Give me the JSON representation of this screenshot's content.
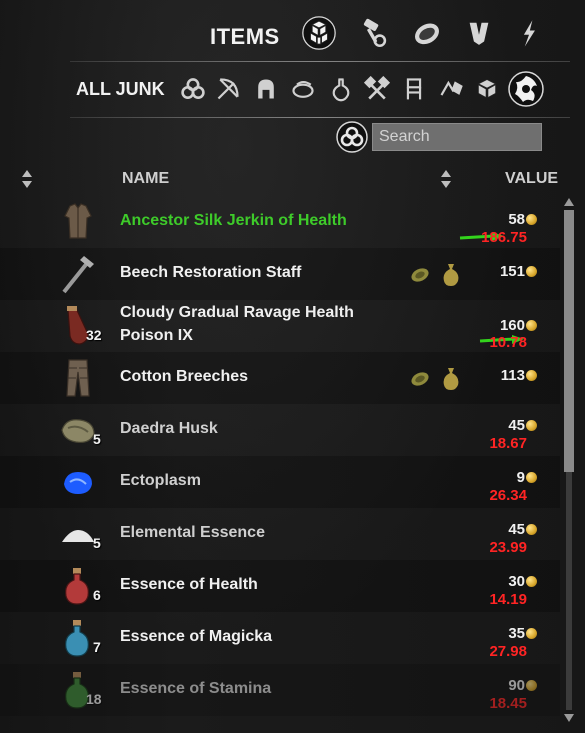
{
  "header": {
    "title": "ITEMS",
    "tabs": [
      {
        "icon": "all-items-cube-icon",
        "selected": true
      },
      {
        "icon": "materials-hammer-icon",
        "selected": false
      },
      {
        "icon": "consumables-food-icon",
        "selected": false
      },
      {
        "icon": "armor-icon",
        "selected": false
      },
      {
        "icon": "weapons-lightning-icon",
        "selected": false
      }
    ]
  },
  "subheader": {
    "title": "ALL JUNK",
    "filters": [
      "all-triquetra-icon",
      "bow-icon",
      "helmet-icon",
      "food-icon",
      "potion-icon",
      "crafting-tools-icon",
      "furnishing-icon",
      "runes-icon",
      "blocks-icon",
      "junk-selected-icon"
    ]
  },
  "search": {
    "placeholder": "Search",
    "value": ""
  },
  "columns": {
    "name": "NAME",
    "value": "VALUE"
  },
  "items": [
    {
      "name": "Ancestor Silk Jerkin of Health",
      "quality_color": "#3ecb2a",
      "value": "58",
      "sell": "186.75",
      "qty": "",
      "icon": "jerkin-icon",
      "traits": false,
      "arrow": true
    },
    {
      "name": "Beech Restoration Staff",
      "quality_color": "#f0f0f0",
      "value": "151",
      "sell": "",
      "qty": "",
      "icon": "staff-icon",
      "traits": true,
      "arrow": false
    },
    {
      "name_line1": "Cloudy Gradual Ravage Health",
      "name_line2": "Poison IX",
      "quality_color": "#f0f0f0",
      "value": "160",
      "sell": "10.78",
      "qty": "32",
      "icon": "poison-icon",
      "traits": false,
      "arrow": true
    },
    {
      "name": "Cotton Breeches",
      "quality_color": "#f0f0f0",
      "value": "113",
      "sell": "",
      "qty": "",
      "icon": "breeches-icon",
      "traits": true,
      "arrow": false
    },
    {
      "name": "Daedra Husk",
      "quality_color": "#cfcfcf",
      "value": "45",
      "sell": "18.67",
      "qty": "5",
      "icon": "husk-icon",
      "traits": false,
      "arrow": false
    },
    {
      "name": "Ectoplasm",
      "quality_color": "#cfcfcf",
      "value": "9",
      "sell": "26.34",
      "qty": "",
      "icon": "ectoplasm-icon",
      "traits": false,
      "arrow": false
    },
    {
      "name": "Elemental Essence",
      "quality_color": "#cfcfcf",
      "value": "45",
      "sell": "23.99",
      "qty": "5",
      "icon": "essence-icon",
      "traits": false,
      "arrow": false
    },
    {
      "name": "Essence of Health",
      "quality_color": "#f0f0f0",
      "value": "30",
      "sell": "14.19",
      "qty": "6",
      "icon": "health-potion-icon",
      "traits": false,
      "arrow": false
    },
    {
      "name": "Essence of Magicka",
      "quality_color": "#f0f0f0",
      "value": "35",
      "sell": "27.98",
      "qty": "7",
      "icon": "magicka-potion-icon",
      "traits": false,
      "arrow": false
    },
    {
      "name": "Essence of Stamina",
      "quality_color": "#a0a0a0",
      "value": "90",
      "sell": "18.45",
      "qty": "18",
      "icon": "stamina-potion-icon",
      "traits": false,
      "arrow": false
    }
  ],
  "colors": {
    "sell_red": "#ff2424",
    "arrow_green": "#33d41c",
    "coin_gold": "#d8a62a"
  }
}
